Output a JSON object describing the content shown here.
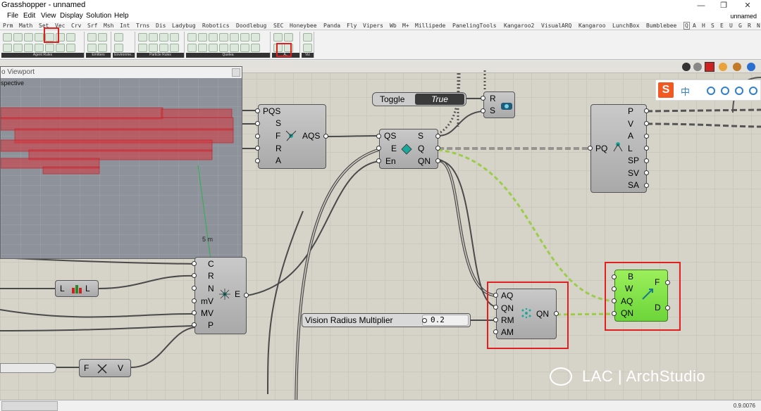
{
  "window": {
    "title": "Grasshopper - unnamed",
    "document_name": "unnamed",
    "minimize": "—",
    "restore": "❐",
    "close": "✕"
  },
  "menu": [
    "File",
    "Edit",
    "View",
    "Display",
    "Solution",
    "Help"
  ],
  "tabs": [
    "Prm",
    "Math",
    "Set",
    "Vec",
    "Crv",
    "Srf",
    "Msh",
    "Int",
    "Trns",
    "Dis",
    "Ladybug",
    "Robotics",
    "Doodlebug",
    "SEC",
    "Honeybee",
    "Panda",
    "Fly",
    "Vipers",
    "Wb",
    "M+",
    "Millipede",
    "PanelingTools",
    "Kangaroo2",
    "VisualARQ",
    "Kangaroo",
    "LunchBox",
    "Bumblebee",
    "Q",
    "A",
    "H",
    "S",
    "E",
    "U",
    "G",
    "R",
    "N"
  ],
  "active_tab": "Q",
  "ribbon_groups": [
    "Agent Rules",
    "Emitters",
    "Environme..",
    "Particle Rules",
    "Quelea",
    "A..",
    "Viz"
  ],
  "viewport": {
    "title": "o Viewport",
    "projection": "spective",
    "scale_label": "5 m"
  },
  "components": {
    "aqs": {
      "inputs": [
        "PQS",
        "S",
        "F",
        "R",
        "A"
      ],
      "output": "AQS"
    },
    "engine": {
      "inputs": [
        "QS",
        "E",
        "En"
      ],
      "outputs": [
        "S",
        "Q",
        "QN"
      ]
    },
    "timer": {
      "inputs": [
        "R",
        "S"
      ]
    },
    "pq": {
      "input": "PQ",
      "outputs": [
        "P",
        "V",
        "A",
        "L",
        "SP",
        "SV",
        "SA"
      ]
    },
    "emitter": {
      "inputs": [
        "C",
        "R",
        "N",
        "mV",
        "MV",
        "P"
      ],
      "output": "E"
    },
    "L": {
      "input": "L",
      "output": "L"
    },
    "fv": {
      "input": "F",
      "output": "V"
    },
    "vision": {
      "inputs": [
        "AQ",
        "QN",
        "RM",
        "AM"
      ],
      "output": "QN"
    },
    "flock": {
      "inputs": [
        "B",
        "W",
        "AQ",
        "QN"
      ],
      "outputs": [
        "F",
        "D"
      ]
    }
  },
  "toggle": {
    "label": "Toggle",
    "value": "True"
  },
  "slider": {
    "label": "Vision Radius Multiplier",
    "value": "0.2"
  },
  "ime": {
    "mode": "中"
  },
  "watermark": "LAC | ArchStudio",
  "status": {
    "zoom": "0.9.0076"
  },
  "colors": {
    "highlight": "#e02020",
    "wire": "#4a4a4a",
    "selected_wire": "#9ccc4a",
    "preview": "#d9333a"
  }
}
